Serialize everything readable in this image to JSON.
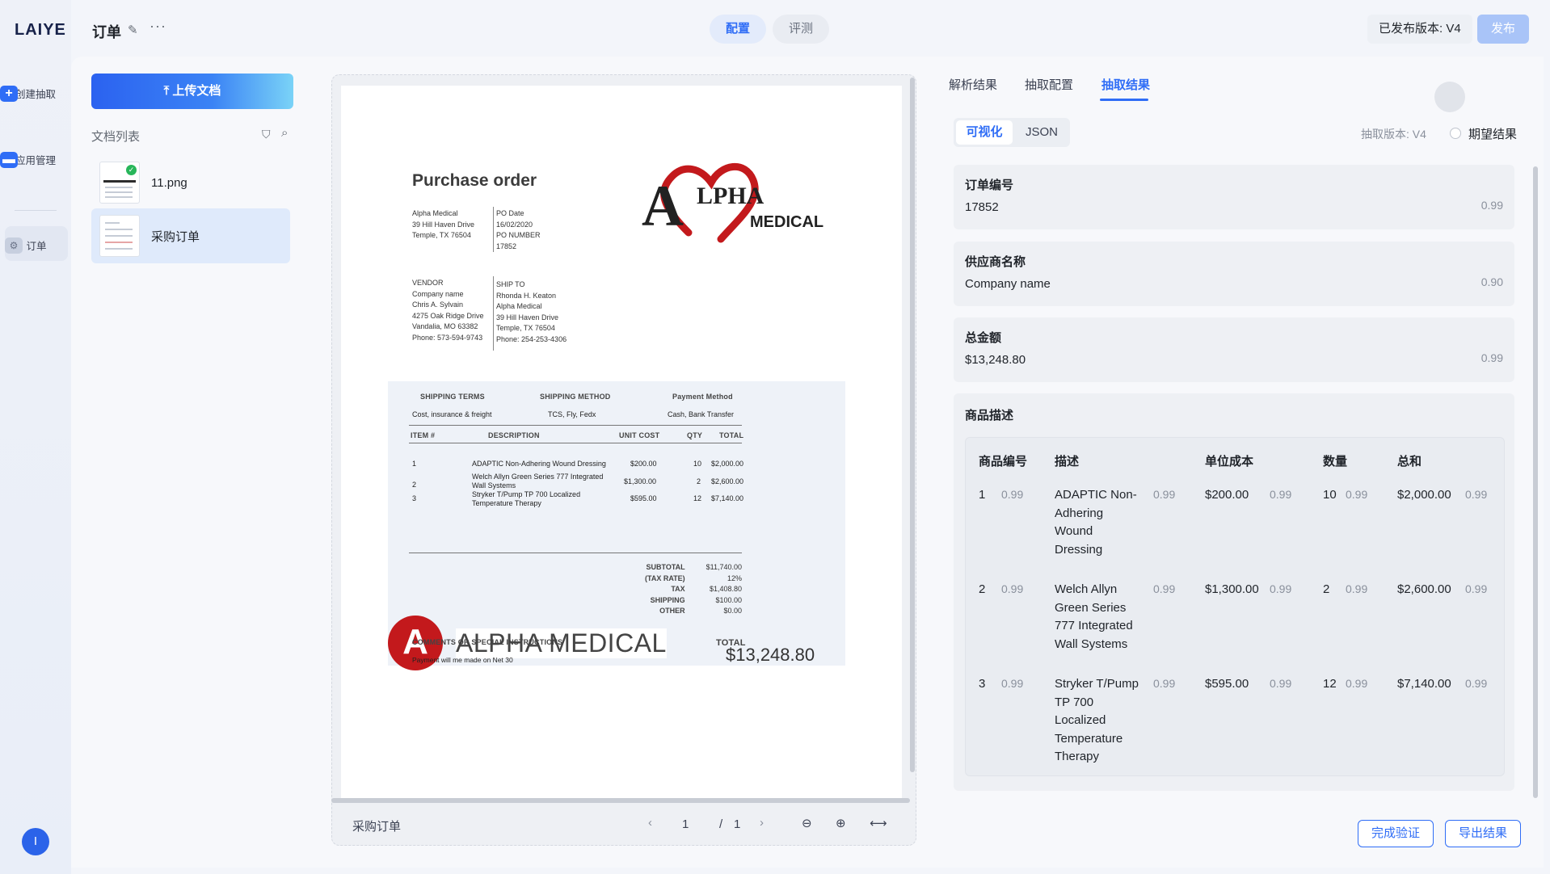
{
  "app": {
    "logo": "LAIYE",
    "doc_title": "订单"
  },
  "rail": {
    "items": [
      {
        "label": "创建抽取",
        "icon": "plus-icon"
      },
      {
        "label": "应用管理",
        "icon": "folder-icon"
      },
      {
        "label": "订单",
        "icon": "doc-gear-icon"
      }
    ],
    "user_initial": "I"
  },
  "header": {
    "tabs": [
      {
        "label": "配置"
      },
      {
        "label": "评测"
      }
    ],
    "version": "已发布版本: V4",
    "publish": "发布"
  },
  "sidebar": {
    "upload": "上传文档",
    "list_label": "文档列表",
    "files": [
      {
        "name": "11.png",
        "verified": true
      },
      {
        "name": "采购订单",
        "verified": false
      }
    ]
  },
  "document": {
    "title": "Purchase order",
    "logo_letter": "A",
    "logo_word": "LPHA",
    "logo_medical": "MEDICAL",
    "bill_from": "Alpha Medical\n39 Hill Haven Drive\nTemple, TX 76504",
    "po_block": "PO Date\n16/02/2020\nPO NUMBER\n17852",
    "vendor_block": "VENDOR\nCompany name\nChris A. Sylvain\n4275 Oak Ridge Drive\nVandalia, MO 63382\nPhone: 573-594-9743",
    "ship_block": "SHIP TO\nRhonda H. Keaton\nAlpha Medical\n39 Hill Haven Drive\nTemple, TX 76504\nPhone: 254-253-4306",
    "terms_headers": [
      "SHIPPING TERMS",
      "SHIPPING METHOD",
      "Payment Method"
    ],
    "terms_values": [
      "Cost, insurance & freight",
      "TCS, Fly, Fedx",
      "Cash, Bank Transfer"
    ],
    "col_headers": [
      "ITEM #",
      "DESCRIPTION",
      "UNIT COST",
      "QTY",
      "TOTAL"
    ],
    "rows": [
      {
        "no": "1",
        "desc": "ADAPTIC Non-Adhering Wound Dressing",
        "unit": "$200.00",
        "qty": "10",
        "total": "$2,000.00"
      },
      {
        "no": "2",
        "desc": "Welch Allyn Green Series 777 Integrated\nWall Systems",
        "unit": "$1,300.00",
        "qty": "2",
        "total": "$2,600.00"
      },
      {
        "no": "3",
        "desc": "Stryker T/Pump TP 700 Localized\nTemperature Therapy",
        "unit": "$595.00",
        "qty": "12",
        "total": "$7,140.00"
      }
    ],
    "summary_labels": "SUBTOTAL\n(TAX RATE)\nTAX\nSHIPPING\nOTHER",
    "summary_values": "$11,740.00\n12%\n$1,408.80\n$100.00\n$0.00",
    "big_logo_letter": "A",
    "big_logo_text": "ALPHA MEDICAL",
    "comments_label": "COMMENTS OR SPECIAL INSTRUCTIONS",
    "comments_text": "Payment will me made on Net 30",
    "total_label": "TOTAL",
    "total_value": "$13,248.80"
  },
  "viewer": {
    "name": "采购订单",
    "page": "1",
    "page_sep": "/",
    "page_total": "1"
  },
  "panel": {
    "tabs": [
      {
        "label": "解析结果"
      },
      {
        "label": "抽取配置"
      },
      {
        "label": "抽取结果"
      }
    ],
    "view_tabs": [
      {
        "label": "可视化"
      },
      {
        "label": "JSON"
      }
    ],
    "extract_version": "抽取版本: V4",
    "expect_label": "期望结果",
    "fields": [
      {
        "title": "订单编号",
        "value": "17852",
        "score": "0.99"
      },
      {
        "title": "供应商名称",
        "value": "Company name",
        "score": "0.90"
      },
      {
        "title": "总金额",
        "value": "$13,248.80",
        "score": "0.99"
      }
    ],
    "items_title": "商品描述",
    "items_headers": [
      "商品编号",
      "描述",
      "单位成本",
      "数量",
      "总和"
    ],
    "items": [
      {
        "no": "1",
        "no_s": "0.99",
        "desc": "ADAPTIC Non-\nAdhering\nWound\nDressing",
        "desc_s": "0.99",
        "unit": "$200.00",
        "unit_s": "0.99",
        "qty": "10",
        "qty_s": "0.99",
        "total": "$2,000.00",
        "total_s": "0.99"
      },
      {
        "no": "2",
        "no_s": "0.99",
        "desc": "Welch Allyn\nGreen Series\n777 Integrated\nWall Systems",
        "desc_s": "0.99",
        "unit": "$1,300.00",
        "unit_s": "0.99",
        "qty": "2",
        "qty_s": "0.99",
        "total": "$2,600.00",
        "total_s": "0.99"
      },
      {
        "no": "3",
        "no_s": "0.99",
        "desc": "Stryker T/Pump\nTP 700\nLocalized\nTemperature\nTherapy",
        "desc_s": "0.99",
        "unit": "$595.00",
        "unit_s": "0.99",
        "qty": "12",
        "qty_s": "0.99",
        "total": "$7,140.00",
        "total_s": "0.99"
      }
    ],
    "complete_btn": "完成验证",
    "export_btn": "导出结果"
  },
  "colors": {
    "accent": "#2f6df6",
    "logo_red": "#c3191c",
    "verified": "#28b65a"
  }
}
